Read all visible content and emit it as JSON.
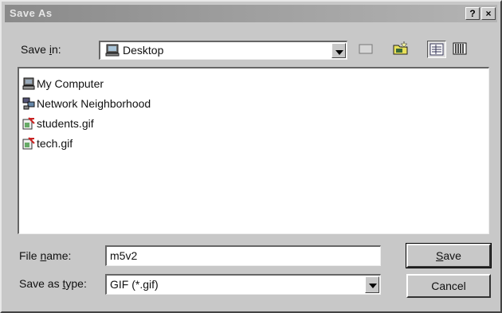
{
  "window": {
    "title": "Save As",
    "help_label": "?",
    "close_label": "×"
  },
  "save_in": {
    "label_pre": "Save ",
    "label_key": "i",
    "label_post": "n:",
    "value": "Desktop",
    "icon": "desktop-icon"
  },
  "toolbar": {
    "up": "up-one-level-icon",
    "desktop": "desktop-icon",
    "new_folder": "new-folder-icon",
    "list": "list-view-icon",
    "details": "details-view-icon"
  },
  "files": [
    {
      "name": "My Computer",
      "icon": "computer-icon"
    },
    {
      "name": "Network Neighborhood",
      "icon": "network-icon"
    },
    {
      "name": "students.gif",
      "icon": "gif-file-icon"
    },
    {
      "name": "tech.gif",
      "icon": "gif-file-icon"
    }
  ],
  "file_name": {
    "label_pre": "File ",
    "label_key": "n",
    "label_post": "ame:",
    "value": "m5v2"
  },
  "save_type": {
    "label_pre": "Save as ",
    "label_key": "t",
    "label_post": "ype:",
    "value": "GIF (*.gif)"
  },
  "buttons": {
    "save_key": "S",
    "save_rest": "ave",
    "cancel": "Cancel"
  },
  "colors": {
    "face": "#c8c8c8",
    "title_start": "#8a8a8a",
    "title_end": "#b4b4b4"
  }
}
